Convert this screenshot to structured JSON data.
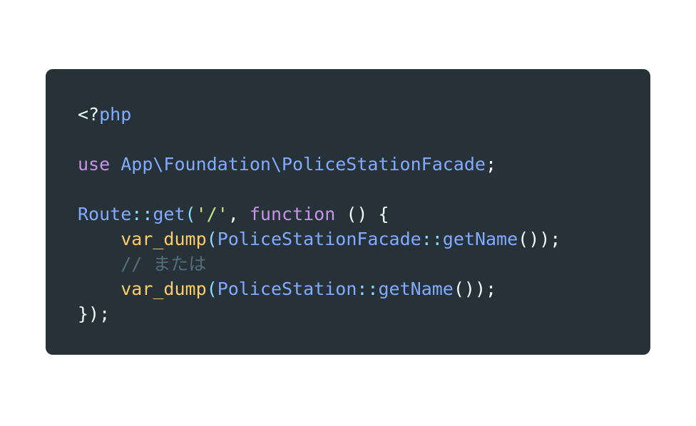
{
  "code": {
    "language": "php",
    "lines": [
      [
        {
          "text": "<?",
          "type": "plain"
        },
        {
          "text": "php",
          "type": "class"
        }
      ],
      [],
      [
        {
          "text": "use",
          "type": "keyword"
        },
        {
          "text": " ",
          "type": "plain"
        },
        {
          "text": "App\\Foundation\\PoliceStationFacade",
          "type": "class"
        },
        {
          "text": ";",
          "type": "plain"
        }
      ],
      [],
      [
        {
          "text": "Route",
          "type": "class"
        },
        {
          "text": "::",
          "type": "punct"
        },
        {
          "text": "get",
          "type": "func"
        },
        {
          "text": "(",
          "type": "punct"
        },
        {
          "text": "'/'",
          "type": "string"
        },
        {
          "text": ", ",
          "type": "plain"
        },
        {
          "text": "function",
          "type": "keyword"
        },
        {
          "text": " () {",
          "type": "plain"
        }
      ],
      [
        {
          "text": "    ",
          "type": "plain"
        },
        {
          "text": "var_dump",
          "type": "builtin"
        },
        {
          "text": "(",
          "type": "punct"
        },
        {
          "text": "PoliceStationFacade",
          "type": "class"
        },
        {
          "text": "::",
          "type": "punct"
        },
        {
          "text": "getName",
          "type": "func"
        },
        {
          "text": "());",
          "type": "plain"
        }
      ],
      [
        {
          "text": "    ",
          "type": "plain"
        },
        {
          "text": "// または",
          "type": "comment"
        }
      ],
      [
        {
          "text": "    ",
          "type": "plain"
        },
        {
          "text": "var_dump",
          "type": "builtin"
        },
        {
          "text": "(",
          "type": "punct"
        },
        {
          "text": "PoliceStation",
          "type": "class"
        },
        {
          "text": "::",
          "type": "punct"
        },
        {
          "text": "getName",
          "type": "func"
        },
        {
          "text": "());",
          "type": "plain"
        }
      ],
      [
        {
          "text": "});",
          "type": "plain"
        }
      ]
    ]
  },
  "colors": {
    "page_background": "#ffffff",
    "card_background": "#263238",
    "plain": "#eeffff",
    "keyword": "#c792ea",
    "class": "#82aaff",
    "builtin": "#ffcb6b",
    "string": "#c3e88d",
    "punct": "#89ddff",
    "comment": "#546e7a"
  }
}
